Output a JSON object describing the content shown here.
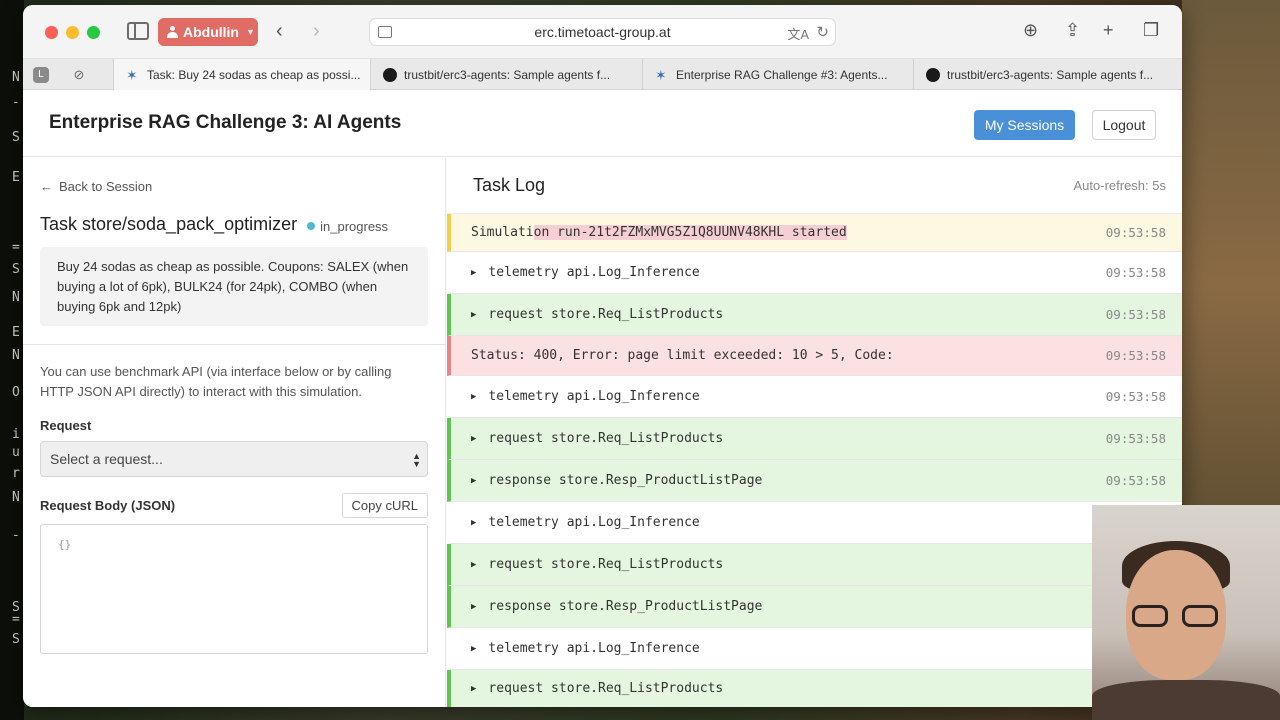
{
  "desktop": {
    "left_glyphs": [
      "N",
      "-",
      "S",
      "E",
      "=",
      "S",
      "N",
      "E",
      "N",
      "O",
      "i",
      "u",
      "r",
      "N",
      "-",
      "S",
      "=",
      "S"
    ]
  },
  "browser": {
    "profile_name": "Abdullin",
    "url": "erc.timetoact-group.at",
    "tabs": [
      {
        "title": "Task: Buy 24 sodas as cheap as possi...",
        "favicon": "star-icon",
        "active": true
      },
      {
        "title": "trustbit/erc3-agents: Sample agents f...",
        "favicon": "github-icon",
        "active": false
      },
      {
        "title": "Enterprise RAG Challenge #3: Agents...",
        "favicon": "star-icon",
        "active": false
      },
      {
        "title": "trustbit/erc3-agents: Sample agents f...",
        "favicon": "github-icon",
        "active": false
      }
    ]
  },
  "header": {
    "title": "Enterprise RAG Challenge 3: AI Agents",
    "sessions_label": "My Sessions",
    "logout_label": "Logout"
  },
  "left": {
    "back_label": "Back to Session",
    "task_title": "Task store/soda_pack_optimizer",
    "status": "in_progress",
    "task_description": "Buy 24 sodas as cheap as possible. Coupons: SALEX (when buying a lot of 6pk), BULK24 (for 24pk), COMBO (when buying 6pk and 12pk)",
    "help_text": "You can use benchmark API (via interface below or by calling HTTP JSON API directly) to interact with this simulation.",
    "request_label": "Request",
    "request_selected": "Select a request...",
    "body_label": "Request Body (JSON)",
    "copy_curl_label": "Copy cURL",
    "body_value": "{}"
  },
  "log": {
    "title": "Task Log",
    "auto_refresh": "Auto-refresh: 5s",
    "entries": [
      {
        "kind": "yellow",
        "prefix": "Simulati",
        "highlight": "on run-21t2FZMxMVG5Z1Q8UUNV48KHL started",
        "expandable": false,
        "time": "09:53:58"
      },
      {
        "kind": "white",
        "text": "telemetry api.Log_Inference",
        "expandable": true,
        "time": "09:53:58"
      },
      {
        "kind": "green",
        "text": "request store.Req_ListProducts",
        "expandable": true,
        "time": "09:53:58"
      },
      {
        "kind": "red",
        "text": "Status: 400, Error: page limit exceeded: 10 > 5, Code:",
        "expandable": false,
        "time": "09:53:58"
      },
      {
        "kind": "white",
        "text": "telemetry api.Log_Inference",
        "expandable": true,
        "time": "09:53:58"
      },
      {
        "kind": "green",
        "text": "request store.Req_ListProducts",
        "expandable": true,
        "time": "09:53:58"
      },
      {
        "kind": "green",
        "text": "response store.Resp_ProductListPage",
        "expandable": true,
        "time": "09:53:58"
      },
      {
        "kind": "white",
        "text": "telemetry api.Log_Inference",
        "expandable": true,
        "time": ""
      },
      {
        "kind": "green",
        "text": "request store.Req_ListProducts",
        "expandable": true,
        "time": ""
      },
      {
        "kind": "green",
        "text": "response store.Resp_ProductListPage",
        "expandable": true,
        "time": ""
      },
      {
        "kind": "white",
        "text": "telemetry api.Log_Inference",
        "expandable": true,
        "time": ""
      },
      {
        "kind": "green",
        "text": "request store.Req_ListProducts",
        "expandable": true,
        "time": ""
      }
    ]
  },
  "colors": {
    "primary_button": "#4a90d9",
    "status_dot": "#4fb8d4",
    "row_green": "#e5f6e0",
    "row_red": "#fbe1e2",
    "row_yellow": "#fdf8e1"
  }
}
